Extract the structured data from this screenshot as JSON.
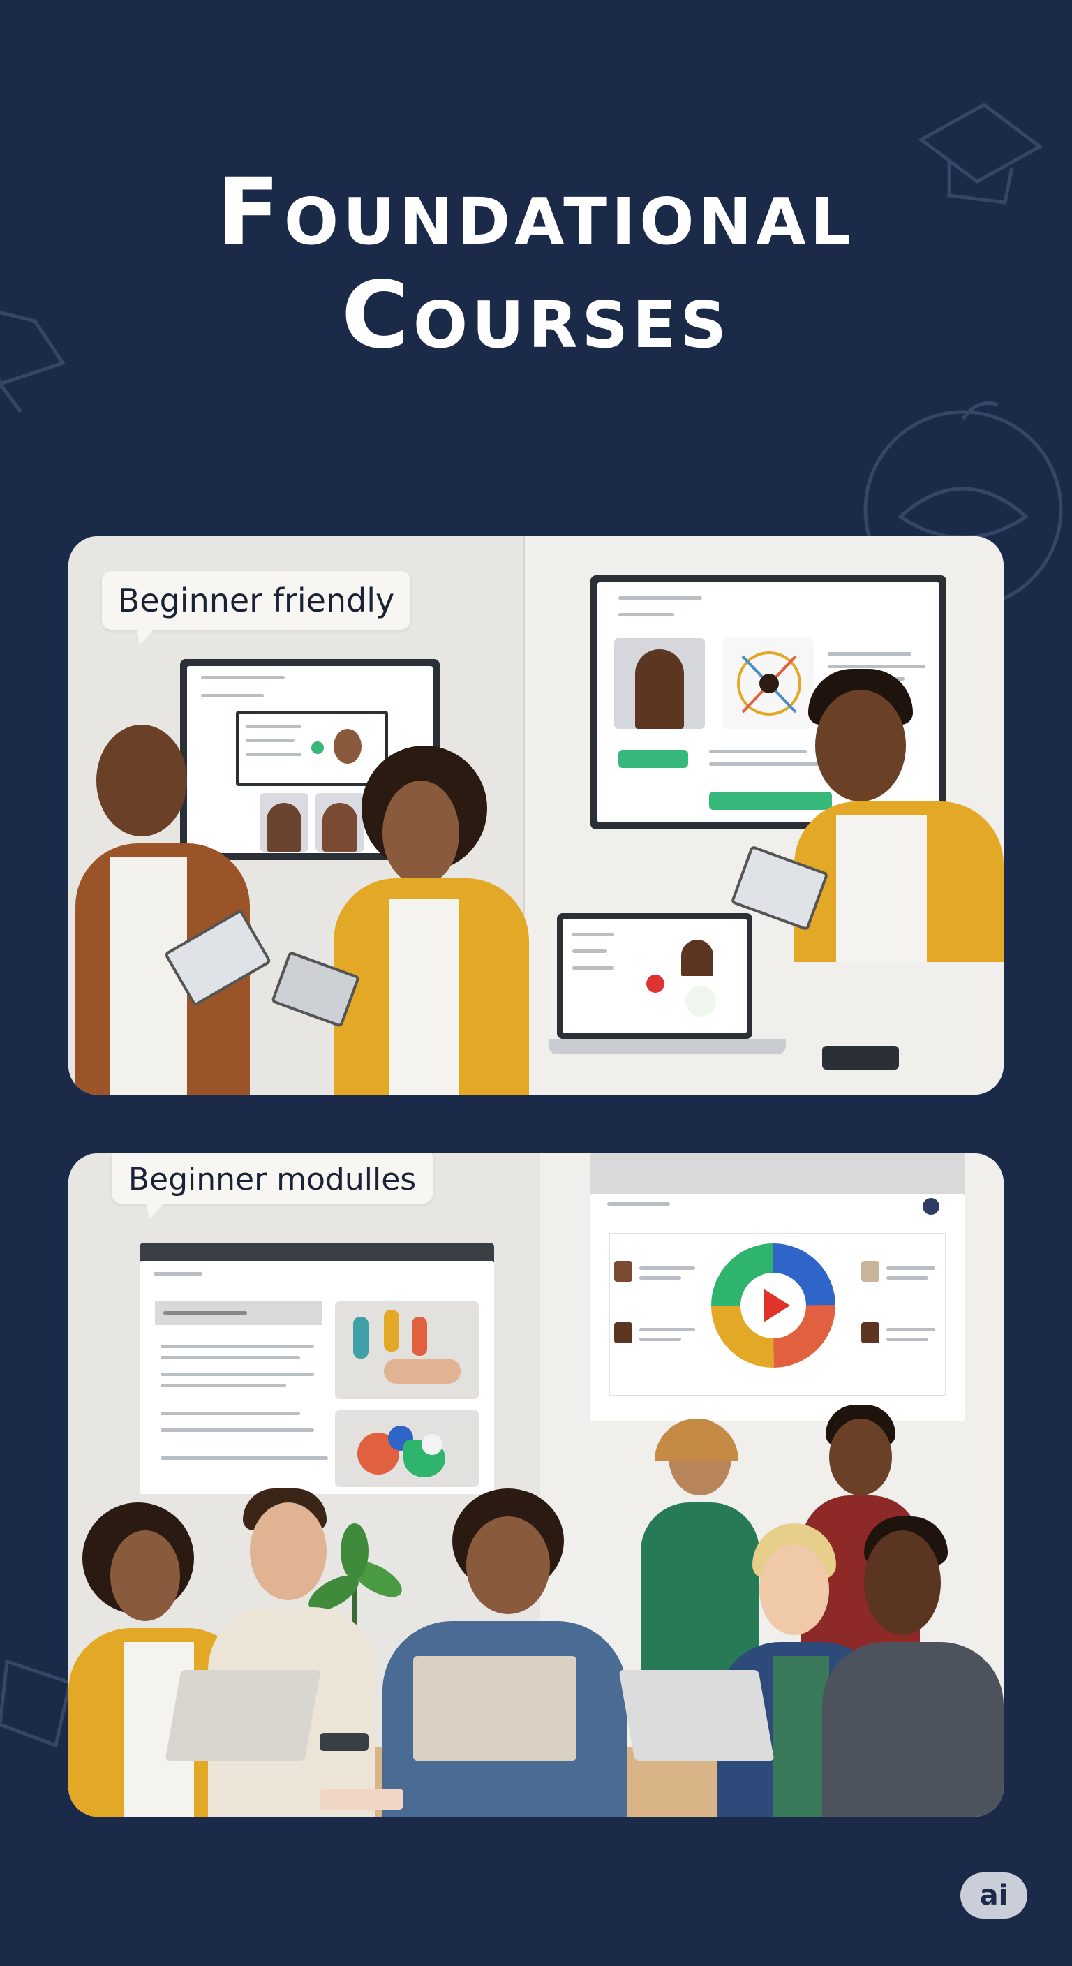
{
  "title": {
    "line1": "Foundational",
    "line2": "Courses"
  },
  "cards": [
    {
      "bubble": "Beginner friendly"
    },
    {
      "bubble": "Beginner modulles"
    }
  ],
  "logo": {
    "text": "ai"
  },
  "icons": [
    "graduation-cap-icon",
    "book-icon",
    "play-icon"
  ],
  "colors": {
    "background": "#1c2a4a",
    "accent_green": "#35b87a",
    "accent_yellow": "#e3a825"
  }
}
